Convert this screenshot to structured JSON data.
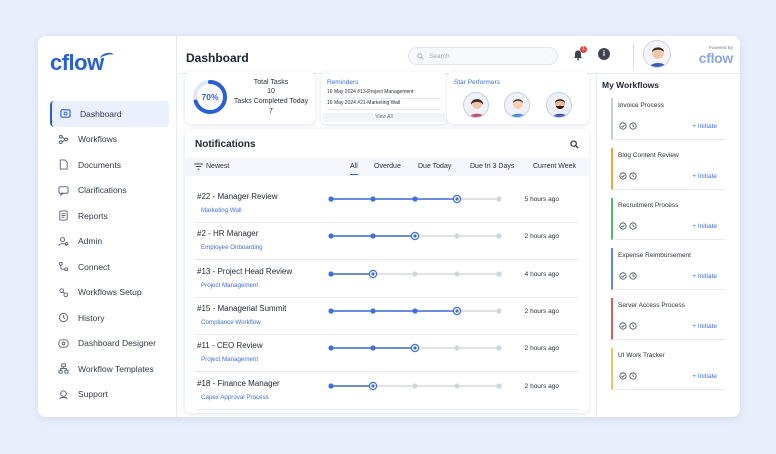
{
  "brand": {
    "logo": "cflow",
    "powered_by": "Powered By",
    "powered_logo": "cflow"
  },
  "sidebar": {
    "items": [
      {
        "label": "Dashboard",
        "icon": "dashboard-icon"
      },
      {
        "label": "Workflows",
        "icon": "workflows-icon"
      },
      {
        "label": "Documents",
        "icon": "documents-icon"
      },
      {
        "label": "Clarifications",
        "icon": "clarifications-icon"
      },
      {
        "label": "Reports",
        "icon": "reports-icon"
      },
      {
        "label": "Admin",
        "icon": "admin-icon"
      },
      {
        "label": "Connect",
        "icon": "connect-icon"
      },
      {
        "label": "Workflows Setup",
        "icon": "workflows-setup-icon"
      },
      {
        "label": "History",
        "icon": "history-icon"
      },
      {
        "label": "Dashboard Designer",
        "icon": "dashboard-designer-icon"
      },
      {
        "label": "Workflow Templates",
        "icon": "workflow-templates-icon"
      },
      {
        "label": "Support",
        "icon": "support-icon"
      }
    ]
  },
  "header": {
    "title": "Dashboard",
    "search_placeholder": "Search",
    "notification_count": "1"
  },
  "tasks": {
    "percent": "70%",
    "percent_value": 0.7,
    "total_label": "Total Tasks",
    "total": "10",
    "completed_label": "Tasks Completed Today",
    "completed": "7"
  },
  "reminders": {
    "title": "Reminders",
    "items": [
      "16 May 2024 #13-Project Management",
      "16 May 2024 #21-Marketing Wall"
    ],
    "view_all": "View All"
  },
  "star_performers": {
    "title": "Star Performers"
  },
  "notifications": {
    "title": "Notifications",
    "sort": "Newest",
    "tabs": [
      "All",
      "Overdue",
      "Due Today",
      "Due In 3 Days",
      "Current Week"
    ],
    "rows": [
      {
        "title": "#22 - Manager Review",
        "subtitle": "Marketing Wall",
        "time": "5 hours ago",
        "step": 4
      },
      {
        "title": "#2 - HR Manager",
        "subtitle": "Employee Onboarding",
        "time": "2 hours ago",
        "step": 3
      },
      {
        "title": "#13 - Project Head Review",
        "subtitle": "Project Management",
        "time": "4 hours ago",
        "step": 2
      },
      {
        "title": "#15 - Managerial Summit",
        "subtitle": "Compliance Workflow",
        "time": "2 hours ago",
        "step": 4
      },
      {
        "title": "#11 - CEO Review",
        "subtitle": "Project Management",
        "time": "2 hours ago",
        "step": 3
      },
      {
        "title": "#18 - Finance Manager",
        "subtitle": "Capex Approval Process",
        "time": "2 hours ago",
        "step": 2
      }
    ]
  },
  "workflows": {
    "title": "My Workflows",
    "initiate_label": "+ Initiate",
    "items": [
      {
        "name": "Invoice Process",
        "color": "#c9cdd6"
      },
      {
        "name": "Blog Content Review",
        "color": "#f0a53c"
      },
      {
        "name": "Recruitment Process",
        "color": "#4cbf5a"
      },
      {
        "name": "Expense Reimbursement",
        "color": "#5b86e5"
      },
      {
        "name": "Server Access Process",
        "color": "#d95c5c"
      },
      {
        "name": "UI Work Tracker",
        "color": "#f0c45a"
      }
    ]
  }
}
